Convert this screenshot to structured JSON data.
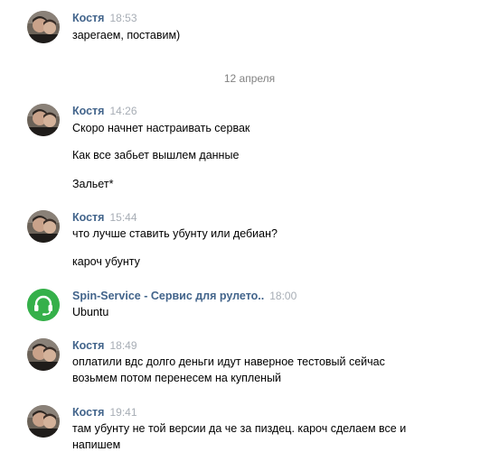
{
  "date_separator": "12 апреля",
  "messages": [
    {
      "author": "Костя",
      "time": "18:53",
      "lines": [
        "зарегаем, поставим)"
      ]
    },
    {
      "author": "Костя",
      "time": "14:26",
      "lines": [
        "Скоро начнет настраивать сервак",
        "Как все забьет вышлем данные",
        "Зальет*"
      ]
    },
    {
      "author": "Костя",
      "time": "15:44",
      "lines": [
        "что лучше ставить убунту или дебиан?",
        "кароч убунту"
      ]
    },
    {
      "author": "Spin-Service - Сервис для рулето..",
      "time": "18:00",
      "lines": [
        "Ubuntu"
      ]
    },
    {
      "author": "Костя",
      "time": "18:49",
      "lines": [
        "оплатили вдс долго деньги идут наверное тестовый сейчас",
        "возьмем потом перенесем на купленый"
      ]
    },
    {
      "author": "Костя",
      "time": "19:41",
      "lines": [
        "там убунту не той версии да че за пиздец. кароч сделаем все и",
        "напишем"
      ]
    }
  ],
  "colors": {
    "author": "#42648b",
    "time": "#a7adb5",
    "text": "#000000",
    "date": "#828282",
    "spin_avatar_bg": "#35b04a"
  },
  "icons": {
    "kostya_avatar": "user-photo-avatar",
    "spin_avatar": "headset-icon"
  }
}
